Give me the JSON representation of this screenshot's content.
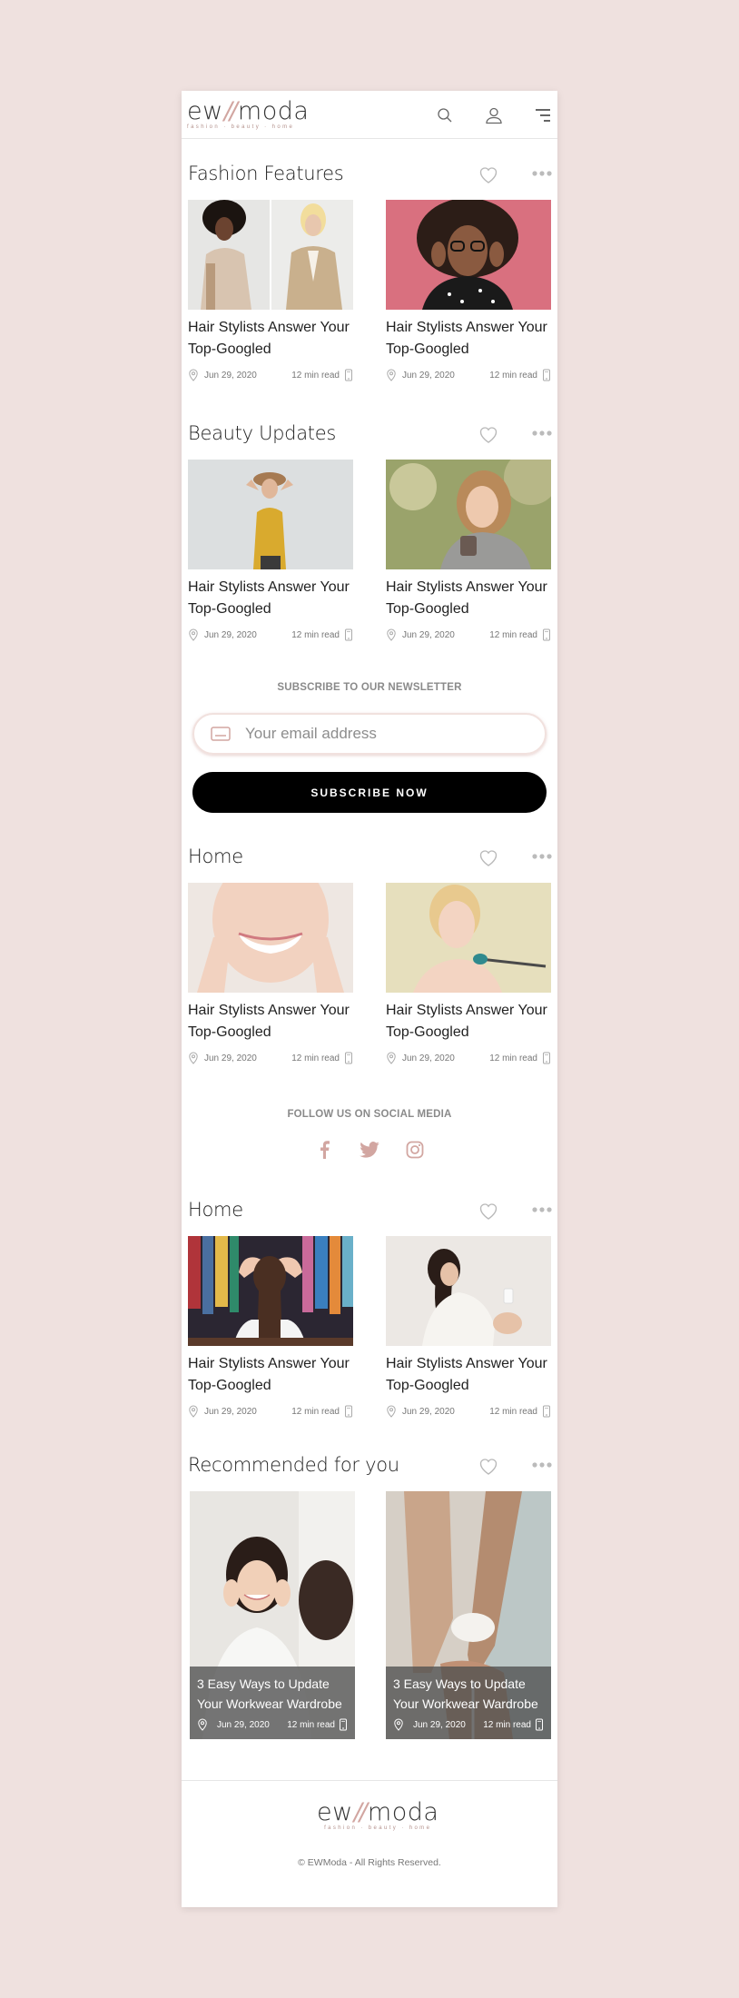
{
  "brand": {
    "logo_left": "ew",
    "logo_slash": "//",
    "logo_right": "moda",
    "tagline": "fashion · beauty · home",
    "accent_color": "#d2a6a1"
  },
  "header": {
    "icons": [
      "search-icon",
      "user-icon",
      "menu-icon"
    ]
  },
  "sections": [
    {
      "title": "Fashion Features",
      "cards": [
        {
          "title": "Hair Stylists Answer Your Top-Googled",
          "date": "Jun 29, 2020",
          "read": "12 min read"
        },
        {
          "title": "Hair Stylists Answer Your Top-Googled",
          "date": "Jun 29, 2020",
          "read": "12 min read"
        }
      ]
    },
    {
      "title": "Beauty Updates",
      "cards": [
        {
          "title": "Hair Stylists Answer Your Top-Googled",
          "date": "Jun 29, 2020",
          "read": "12 min read"
        },
        {
          "title": "Hair Stylists Answer Your Top-Googled",
          "date": "Jun 29, 2020",
          "read": "12 min read"
        }
      ]
    },
    {
      "title": "Home",
      "cards": [
        {
          "title": "Hair Stylists Answer Your Top-Googled",
          "date": "Jun 29, 2020",
          "read": "12 min read"
        },
        {
          "title": "Hair Stylists Answer Your Top-Googled",
          "date": "Jun 29, 2020",
          "read": "12 min read"
        }
      ]
    },
    {
      "title": "Home",
      "cards": [
        {
          "title": "Hair Stylists Answer Your Top-Googled",
          "date": "Jun 29, 2020",
          "read": "12 min read"
        },
        {
          "title": "Hair Stylists Answer Your Top-Googled",
          "date": "Jun 29, 2020",
          "read": "12 min read"
        }
      ]
    }
  ],
  "newsletter": {
    "heading": "SUBSCRIBE TO OUR NEWSLETTER",
    "placeholder": "Your email address",
    "button": "SUBSCRIBE NOW"
  },
  "social": {
    "heading": "FOLLOW US ON SOCIAL MEDIA",
    "icons": [
      "facebook-icon",
      "twitter-icon",
      "instagram-icon"
    ]
  },
  "recommended": {
    "title": "Recommended for you",
    "cards": [
      {
        "title": "3 Easy Ways to Update Your Workwear Wardrobe",
        "date": "Jun 29, 2020",
        "read": "12 min read"
      },
      {
        "title": "3 Easy Ways to Update Your Workwear Wardrobe",
        "date": "Jun 29, 2020",
        "read": "12 min read"
      }
    ]
  },
  "footer": {
    "copyright": "© EWModa - All Rights Reserved."
  }
}
